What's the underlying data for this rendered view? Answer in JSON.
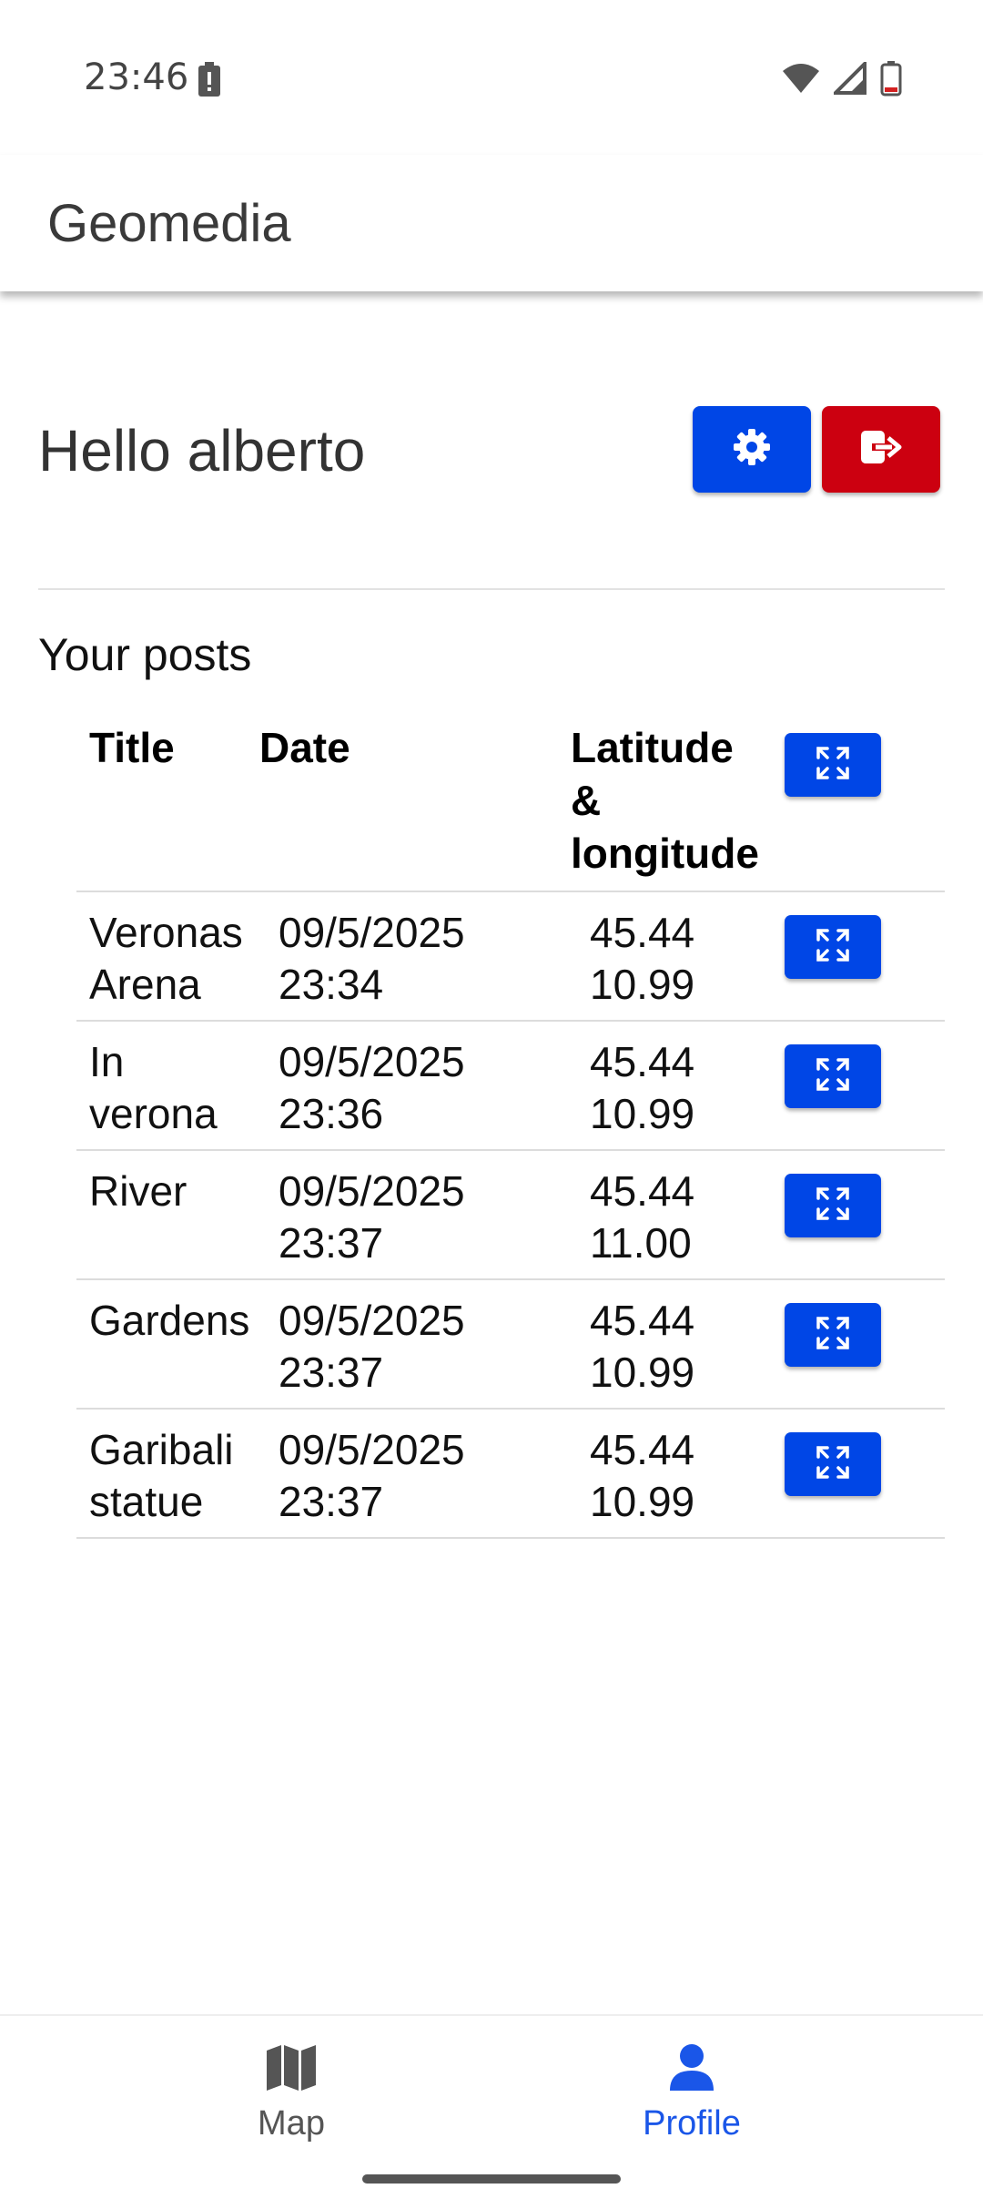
{
  "status_bar": {
    "time": "23:46"
  },
  "app_bar": {
    "title": "Geomedia"
  },
  "greeting": "Hello alberto",
  "posts_title": "Your posts",
  "table": {
    "headers": {
      "title": "Title",
      "date": "Date",
      "latlng_line1": "Latitude",
      "latlng_line2": "&",
      "latlng_line3": "longitude"
    },
    "rows": [
      {
        "title": "Veronas\nArena",
        "date1": "09/5/2025",
        "date2": "23:34",
        "lat": "45.44",
        "lng": "10.99"
      },
      {
        "title": "In\nverona",
        "date1": "09/5/2025",
        "date2": "23:36",
        "lat": "45.44",
        "lng": "10.99"
      },
      {
        "title": "River",
        "date1": "09/5/2025",
        "date2": "23:37",
        "lat": "45.44",
        "lng": "11.00"
      },
      {
        "title": "Gardens",
        "date1": "09/5/2025",
        "date2": "23:37",
        "lat": "45.44",
        "lng": "10.99"
      },
      {
        "title": "Garibali\nstatue",
        "date1": "09/5/2025",
        "date2": "23:37",
        "lat": "45.44",
        "lng": "10.99"
      }
    ]
  },
  "bottom_nav": {
    "items": [
      {
        "label": "Map",
        "icon": "map-icon",
        "active": false
      },
      {
        "label": "Profile",
        "icon": "person-icon",
        "active": true
      }
    ]
  },
  "colors": {
    "primary": "#0046e6",
    "danger": "#cc0010",
    "active_nav": "#1a56e8"
  }
}
